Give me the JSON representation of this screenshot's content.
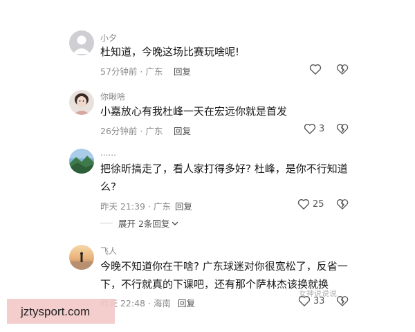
{
  "comments": [
    {
      "username": "小夕",
      "text": "杜知道，今晚这场比赛玩啥呢!",
      "time_location": "57分钟前 · 广东",
      "reply_label": "回复",
      "likes": "",
      "avatar": "gray-default-avatar"
    },
    {
      "username": "你瞅啥",
      "text": "小嘉放心有我杜峰一天在宏远你就是首发",
      "time_location": "26分钟前 · 广东",
      "reply_label": "回复",
      "likes": "3",
      "avatar": "portrait-avatar"
    },
    {
      "username": "......",
      "text": "把徐昕搞走了，看人家打得多好? 杜峰，是你不行知道么?",
      "time_location": "昨天 21:39 · 广东",
      "reply_label": "回复",
      "likes": "25",
      "avatar": "landscape-avatar",
      "expand_label": "展开 2条回复"
    },
    {
      "username": "飞人",
      "text": "今晚不知道你在干啥? 广东球迷对你很宽松了，反省一下，不行就真的下课吧，还有那个萨林杰该换就换",
      "time_location": "昨天 22:48 · 海南",
      "reply_label": "回复",
      "likes": "33",
      "avatar": "sunset-avatar"
    }
  ],
  "watermark": {
    "site": "jztysport.com",
    "signature": "女神说说说"
  },
  "colors": {
    "text": "#161616",
    "meta": "#8a8a8a",
    "watermark_bg": "#f3c9c9"
  },
  "icons": [
    "heart-icon",
    "broken-heart-icon",
    "chevron-down-icon"
  ]
}
